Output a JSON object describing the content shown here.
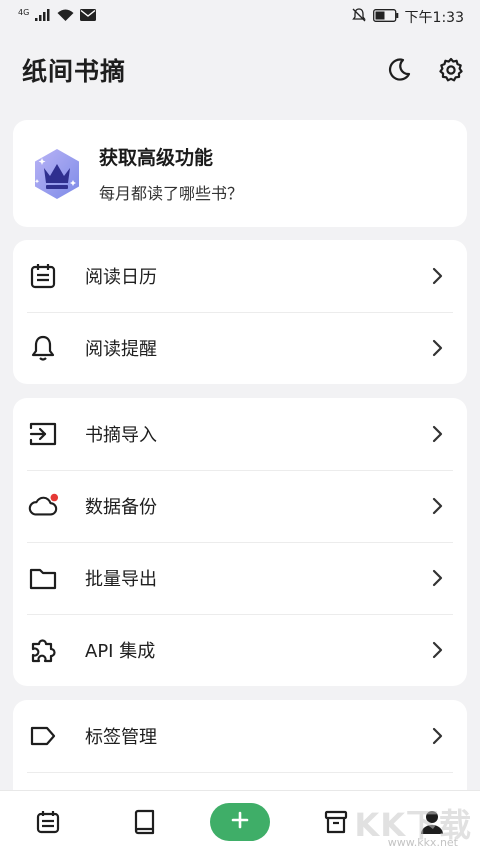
{
  "status_bar": {
    "network": "4G",
    "time": "下午1:33",
    "icons": [
      "signal-icon",
      "wifi-icon",
      "mail-icon",
      "mute-icon",
      "battery-icon"
    ]
  },
  "header": {
    "title": "纸间书摘",
    "icons": [
      "moon-icon",
      "gear-icon"
    ]
  },
  "premium": {
    "title": "获取高级功能",
    "subtitle": "每月都读了哪些书？",
    "icon": "crown-badge-icon"
  },
  "groups": [
    {
      "items": [
        {
          "label": "阅读日历",
          "icon": "calendar-icon"
        },
        {
          "label": "阅读提醒",
          "icon": "bell-icon"
        }
      ]
    },
    {
      "items": [
        {
          "label": "书摘导入",
          "icon": "import-icon"
        },
        {
          "label": "数据备份",
          "icon": "cloud-icon",
          "badge": "red-dot"
        },
        {
          "label": "批量导出",
          "icon": "folder-icon"
        },
        {
          "label": "API 集成",
          "icon": "puzzle-icon"
        }
      ]
    },
    {
      "items": [
        {
          "label": "标签管理",
          "icon": "tag-icon"
        }
      ]
    }
  ],
  "bottom_nav": {
    "items": [
      "calendar-icon",
      "book-icon",
      "add-icon",
      "archive-icon",
      "profile-icon"
    ]
  },
  "watermark": {
    "main": "KK下载",
    "url": "www.kkx.net"
  },
  "colors": {
    "accent": "#3fae68",
    "background": "#f2f2f4",
    "card": "#ffffff",
    "badge_red": "#e53935",
    "crown_blue": "#2f2f8f"
  }
}
